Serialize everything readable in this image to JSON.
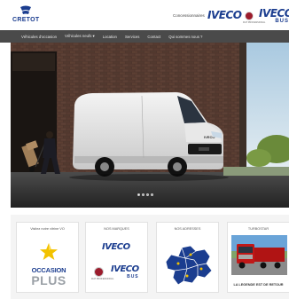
{
  "header": {
    "logo_text": "CRETOT",
    "dealers_link": "Concessionnaires",
    "brand_iveco": "IVECO",
    "brand_fiat_sub": "FIAT PROFESSIONAL",
    "brand_iveco_bus": "IVECO",
    "brand_iveco_bus_sub": "BUS"
  },
  "nav": {
    "items": [
      {
        "label": "Véhicules d'occasion"
      },
      {
        "label": "Véhicules neufs ▾"
      },
      {
        "label": "Location"
      },
      {
        "label": "Services"
      },
      {
        "label": "Contact"
      },
      {
        "label": "Qui sommes nous ?"
      }
    ]
  },
  "hero": {
    "slide_index": 1,
    "slide_count": 4,
    "van_badge": "IVECO"
  },
  "cards": [
    {
      "title": "Visitez notre vitrine VO",
      "brand_line1": "OCCASION",
      "brand_line2": "PLUS"
    },
    {
      "title": "NOS MARQUES",
      "iveco": "IVECO",
      "fiat_sub": "FIAT PROFESSIONAL",
      "iveco_bus": "IVECO",
      "iveco_bus_sub": "BUS"
    },
    {
      "title": "NOS ADRESSES"
    },
    {
      "title": "TURBOSTAR",
      "caption": "LA LEGENDE EST DE RETOUR"
    }
  ],
  "colors": {
    "brand_blue": "#1b3d8f",
    "nav_bg": "#4a4a4a",
    "fiat_red": "#9b1c2c",
    "star_yellow": "#f2c200"
  }
}
